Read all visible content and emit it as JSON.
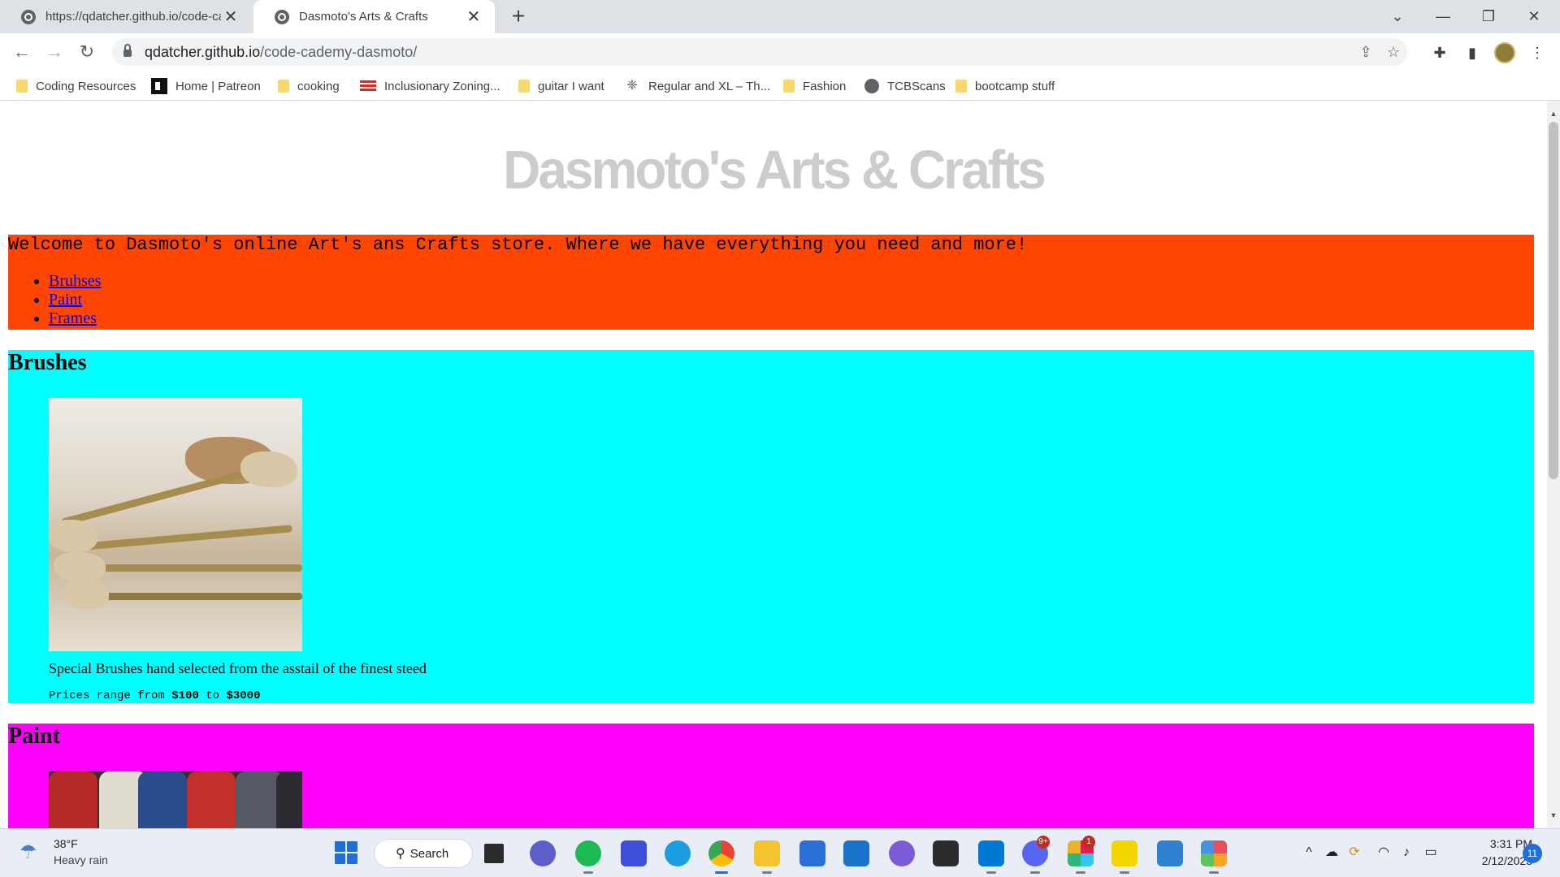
{
  "browser": {
    "tabs": [
      {
        "title": "https://qdatcher.github.io/code-cadem"
      },
      {
        "title": "Dasmoto's Arts & Crafts"
      }
    ],
    "address": {
      "host": "qdatcher.github.io",
      "path": "/code-cademy-dasmoto/"
    },
    "bookmarks": [
      {
        "label": "Coding Resources",
        "icon": "folder-icon"
      },
      {
        "label": "Home | Patreon",
        "icon": "patreon-icon"
      },
      {
        "label": "cooking",
        "icon": "folder-icon"
      },
      {
        "label": "Inclusionary Zoning...",
        "icon": "flag-icon"
      },
      {
        "label": "guitar I want",
        "icon": "folder-icon"
      },
      {
        "label": "Regular and XL – Th...",
        "icon": "leaf-icon"
      },
      {
        "label": "Fashion",
        "icon": "folder-icon"
      },
      {
        "label": "TCBScans",
        "icon": "globe-icon"
      },
      {
        "label": "bootcamp stuff",
        "icon": "folder-icon"
      }
    ]
  },
  "page": {
    "title": "Dasmoto's Arts & Crafts",
    "welcome": "Welcome to Dasmoto's online Art's ans Crafts store. Where we have everything you need and more!",
    "nav": [
      "Bruhses",
      "Paint",
      "Frames"
    ],
    "sections": {
      "brushes": {
        "heading": "Brushes",
        "description": "Special Brushes hand selected from the asstail of the finest steed",
        "prices_prefix": "Prices range from",
        "price_low": "$100",
        "prices_mid": "to",
        "price_high": "$3000"
      },
      "paint": {
        "heading": "Paint"
      }
    },
    "colors": {
      "title": "#cccccc",
      "welcome_bg": "#ff4500",
      "brushes_bg": "#00ffff",
      "paint_bg": "#ff00ff"
    }
  },
  "taskbar": {
    "weather": {
      "temp": "38°F",
      "desc": "Heavy rain"
    },
    "search_label": "Search",
    "clock": {
      "time": "3:31 PM",
      "date": "2/12/2023"
    },
    "notification_count": "11",
    "badges": {
      "discord": "9+",
      "slack": "1"
    }
  }
}
